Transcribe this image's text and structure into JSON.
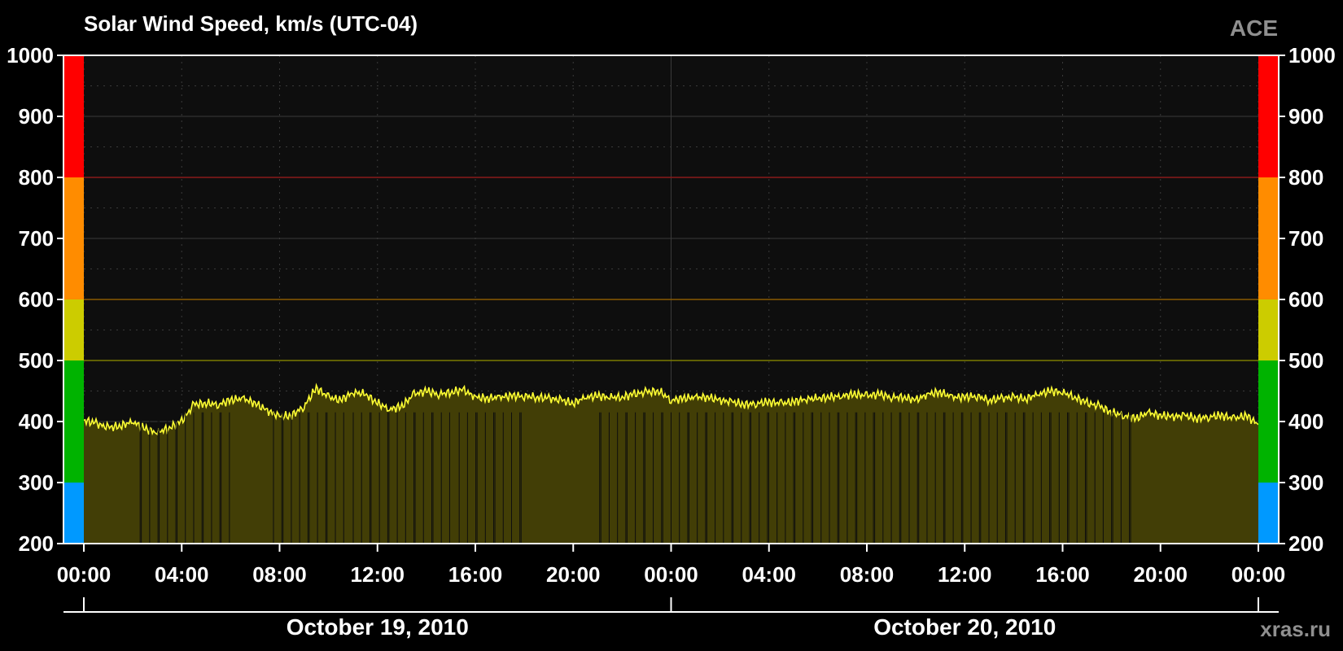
{
  "title": "Solar Wind Speed, km/s (UTC-04)",
  "source_label": "ACE",
  "credit": "xras.ru",
  "colors": {
    "background": "#000000",
    "plot_background": "#0e0e0e",
    "series_line": "#ffff33",
    "series_fill": "#423e06",
    "grid": "#3a3a3a",
    "frame": "#ffffff"
  },
  "chart_data": {
    "type": "area",
    "ylim": [
      200,
      1000
    ],
    "yticks": [
      "200",
      "300",
      "400",
      "500",
      "600",
      "700",
      "800",
      "900",
      "1000"
    ],
    "xlim_hours": [
      0,
      48
    ],
    "xticks": [
      "00:00",
      "04:00",
      "08:00",
      "12:00",
      "16:00",
      "20:00",
      "00:00",
      "04:00",
      "08:00",
      "12:00",
      "16:00",
      "20:00",
      "00:00"
    ],
    "date_labels": [
      "October 19, 2010",
      "October 20, 2010"
    ],
    "grid": true,
    "speed_bands": [
      {
        "from": 200,
        "to": 300,
        "color": "#0099ff"
      },
      {
        "from": 300,
        "to": 500,
        "color": "#00b300"
      },
      {
        "from": 500,
        "to": 600,
        "color": "#cccc00"
      },
      {
        "from": 600,
        "to": 800,
        "color": "#ff8c00"
      },
      {
        "from": 800,
        "to": 1000,
        "color": "#ff0000"
      }
    ],
    "threshold_lines": [
      {
        "value": 500,
        "color": "#7a7a00"
      },
      {
        "value": 600,
        "color": "#8a5a00"
      },
      {
        "value": 800,
        "color": "#8a1a1a"
      }
    ],
    "series": [
      {
        "x": [
          0,
          0.5,
          1,
          1.5,
          2,
          2.5,
          3,
          3.5,
          4,
          4.5,
          5,
          5.5,
          6,
          6.5,
          7,
          7.5,
          8,
          8.5,
          9,
          9.5,
          10,
          10.5,
          11,
          11.5,
          12,
          12.5,
          13,
          13.5,
          14,
          14.5,
          15,
          15.5,
          16,
          16.5,
          17,
          17.5,
          18,
          18.5,
          19,
          19.5,
          20,
          20.5,
          21,
          21.5,
          22,
          22.5,
          23,
          23.5,
          24,
          24.5,
          25,
          25.5,
          26,
          26.5,
          27,
          27.5,
          28,
          28.5,
          29,
          29.5,
          30,
          30.5,
          31,
          31.5,
          32,
          32.5,
          33,
          33.5,
          34,
          34.5,
          35,
          35.5,
          36,
          36.5,
          37,
          37.5,
          38,
          38.5,
          39,
          39.5,
          40,
          40.5,
          41,
          41.5,
          42,
          42.5,
          43,
          43.5,
          44,
          44.5,
          45,
          45.5,
          46,
          46.5,
          47,
          47.5,
          48
        ],
        "y": [
          402,
          397,
          390,
          393,
          400,
          388,
          382,
          390,
          400,
          428,
          430,
          428,
          435,
          438,
          430,
          418,
          408,
          410,
          425,
          455,
          440,
          435,
          448,
          445,
          430,
          420,
          425,
          445,
          450,
          445,
          448,
          452,
          440,
          438,
          440,
          442,
          442,
          440,
          438,
          435,
          430,
          440,
          442,
          440,
          440,
          445,
          448,
          450,
          435,
          438,
          440,
          440,
          435,
          432,
          428,
          430,
          432,
          430,
          432,
          437,
          438,
          440,
          442,
          445,
          442,
          445,
          440,
          440,
          435,
          445,
          448,
          440,
          440,
          442,
          435,
          438,
          440,
          437,
          445,
          450,
          448,
          440,
          430,
          425,
          415,
          410,
          405,
          415,
          410,
          408,
          410,
          405,
          408,
          410,
          405,
          410,
          395
        ]
      }
    ]
  }
}
